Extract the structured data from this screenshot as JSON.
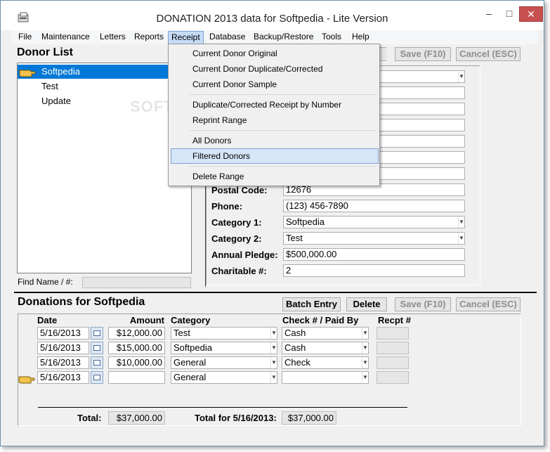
{
  "window": {
    "title": "DONATION 2013 data for Softpedia - Lite Version",
    "min_glyph": "–",
    "max_glyph": "□",
    "close_glyph": "✕"
  },
  "menu": {
    "items": [
      "File",
      "Maintenance",
      "Letters",
      "Reports",
      "Receipt",
      "Database",
      "Backup/Restore",
      "Tools",
      "Help"
    ]
  },
  "receipt_menu": {
    "items": [
      "Current Donor Original",
      "Current Donor Duplicate/Corrected",
      "Current Donor Sample",
      "Duplicate/Corrected Receipt by Number",
      "Reprint Range",
      "All Donors",
      "Filtered Donors",
      "Delete Range"
    ],
    "highlighted": "Filtered Donors"
  },
  "donor_list": {
    "header": "Donor List",
    "items": [
      "Softpedia",
      "Test",
      "Update"
    ],
    "selected": "Softpedia",
    "find_label": "Find Name / #:",
    "find_value": ""
  },
  "donor_toolbar": {
    "save_label": "Save (F10)",
    "cancel_label": "Cancel (ESC)"
  },
  "donor_form": {
    "fields": [
      {
        "label": "Postal Code:",
        "value": "12676"
      },
      {
        "label": "Phone:",
        "value": "(123) 456-7890"
      },
      {
        "label": "Category 1:",
        "value": "Softpedia"
      },
      {
        "label": "Category 2:",
        "value": "Test"
      },
      {
        "label": "Annual Pledge:",
        "value": "$500,000.00"
      },
      {
        "label": "Charitable #:",
        "value": "2"
      }
    ]
  },
  "donations": {
    "header": "Donations for Softpedia",
    "batch_label": "Batch Entry",
    "delete_label": "Delete",
    "save_label": "Save (F10)",
    "cancel_label": "Cancel (ESC)",
    "columns": [
      "Date",
      "Amount",
      "Category",
      "Check # / Paid By",
      "Recpt #"
    ],
    "rows": [
      {
        "date": "5/16/2013",
        "amount": "$12,000.00",
        "category": "Test",
        "check": "Cash",
        "recpt": ""
      },
      {
        "date": "5/16/2013",
        "amount": "$15,000.00",
        "category": "Softpedia",
        "check": "Cash",
        "recpt": ""
      },
      {
        "date": "5/16/2013",
        "amount": "$10,000.00",
        "category": "General",
        "check": "Check",
        "recpt": ""
      },
      {
        "date": "5/16/2013",
        "amount": "",
        "category": "General",
        "check": "",
        "recpt": ""
      }
    ],
    "total_label": "Total:",
    "total_value": "$37,000.00",
    "total_date_label": "Total for 5/16/2013:",
    "total_date_value": "$37,000.00"
  },
  "watermark": "SOFTPEDIA"
}
